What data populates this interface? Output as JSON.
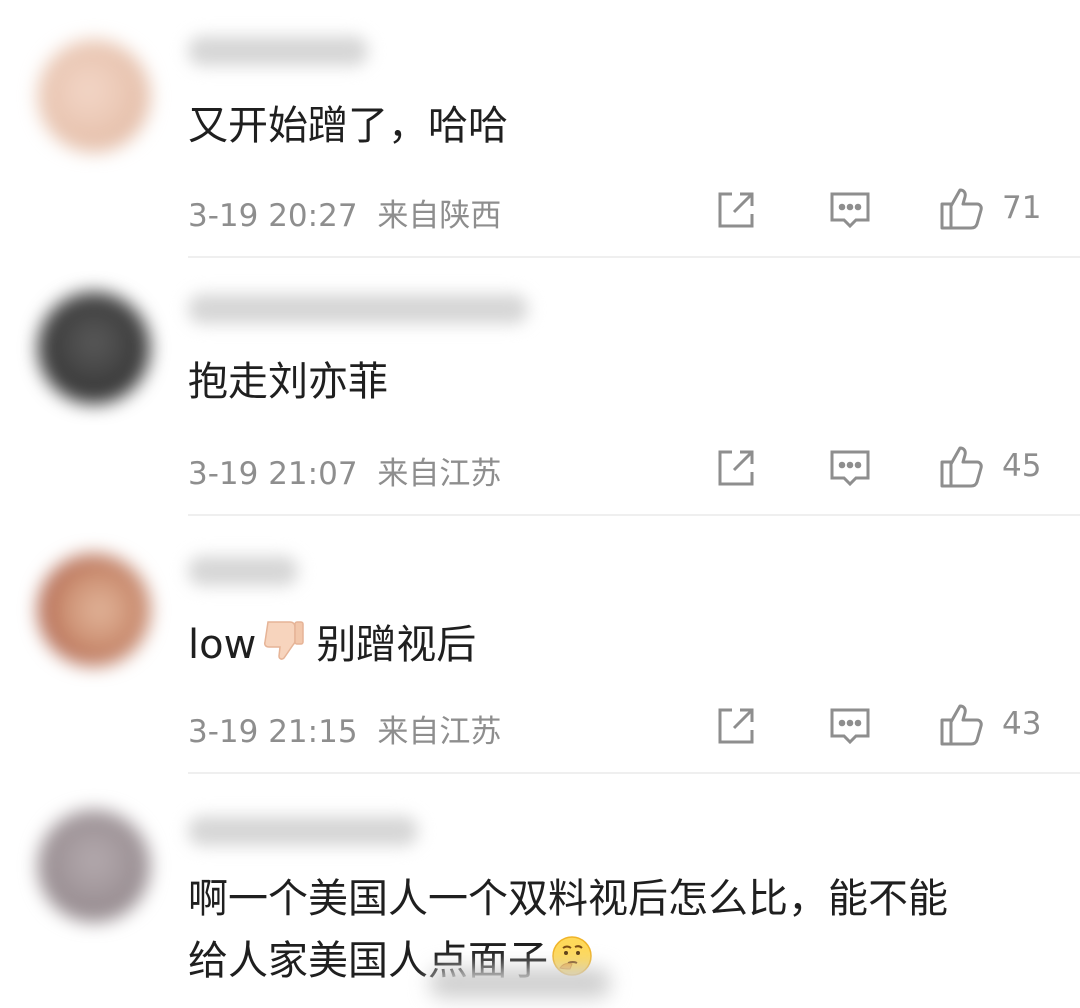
{
  "comments": [
    {
      "content": "又开始蹭了，哈哈",
      "time": "3-19 20:27",
      "location": "来自陕西",
      "likes": "71",
      "avatar_color": "#e9c7b6"
    },
    {
      "content": "抱走刘亦菲",
      "time": "3-19 21:07",
      "location": "来自江苏",
      "likes": "45",
      "avatar_color": "#4a4a4a"
    },
    {
      "content_pre": "low",
      "content_post": "别蹭视后",
      "time": "3-19 21:15",
      "location": "来自江苏",
      "likes": "43",
      "avatar_color": "#c98b6e"
    },
    {
      "content_line1": "啊一个美国人一个双料视后怎么比，能不能",
      "content_line2": "给人家美国人点面子",
      "avatar_color": "#9a8f93"
    }
  ],
  "icons": {
    "share": "share-icon",
    "comment": "comment-icon",
    "like": "thumb-up-icon"
  },
  "colors": {
    "meta_text": "#8e8e8e",
    "content_text": "#1f1f1f",
    "divider": "#efefef"
  }
}
